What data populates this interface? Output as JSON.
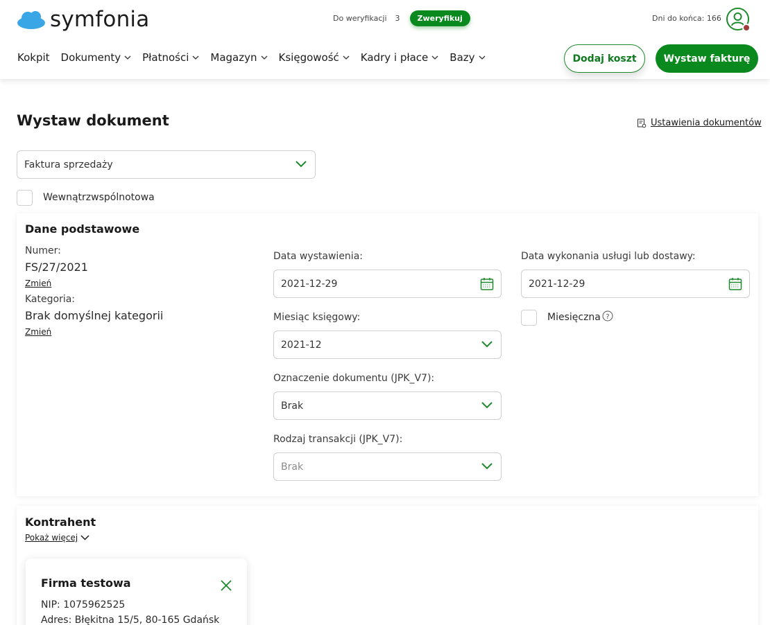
{
  "brand": {
    "name": "symfonia",
    "accent": "#0a8a1e",
    "logo_blue": "#3aa6e6"
  },
  "header": {
    "verify_label": "Do weryfikacji",
    "verify_count": "3",
    "verify_button": "Zweryfikuj",
    "days_left": "Dni do końca: 166",
    "nav": [
      {
        "label": "Kokpit",
        "dropdown": false
      },
      {
        "label": "Dokumenty",
        "dropdown": true
      },
      {
        "label": "Płatności",
        "dropdown": true
      },
      {
        "label": "Magazyn",
        "dropdown": true
      },
      {
        "label": "Księgowość",
        "dropdown": true
      },
      {
        "label": "Kadry i płace",
        "dropdown": true
      },
      {
        "label": "Bazy",
        "dropdown": true
      }
    ],
    "add_cost_button": "Dodaj koszt",
    "issue_invoice_button": "Wystaw fakturę"
  },
  "page": {
    "title": "Wystaw dokument",
    "doc_settings_link": "Ustawienia dokumentów",
    "doc_type_select": "Faktura sprzedaży",
    "intra_community_label": "Wewnątrzwspólnotowa"
  },
  "basic": {
    "title": "Dane podstawowe",
    "number_label": "Numer:",
    "number_value": "FS/27/2021",
    "change_link": "Zmień",
    "category_label": "Kategoria:",
    "category_value": "Brak domyślnej kategorii",
    "issue_date_label": "Data wystawienia:",
    "issue_date_value": "2021-12-29",
    "service_date_label": "Data wykonania usługi lub dostawy:",
    "service_date_value": "2021-12-29",
    "monthly_label": "Miesięczna",
    "accounting_month_label": "Miesiąc księgowy:",
    "accounting_month_value": "2021-12",
    "doc_marking_label": "Oznaczenie dokumentu (JPK_V7):",
    "doc_marking_value": "Brak",
    "transaction_type_label": "Rodzaj transakcji (JPK_V7):",
    "transaction_type_value": "Brak"
  },
  "contractor": {
    "title": "Kontrahent",
    "show_more": "Pokaż więcej",
    "company_name": "Firma testowa",
    "nip": "NIP: 1075962525",
    "address": "Adres: Błękitna 15/5, 80-165 Gdańsk"
  }
}
